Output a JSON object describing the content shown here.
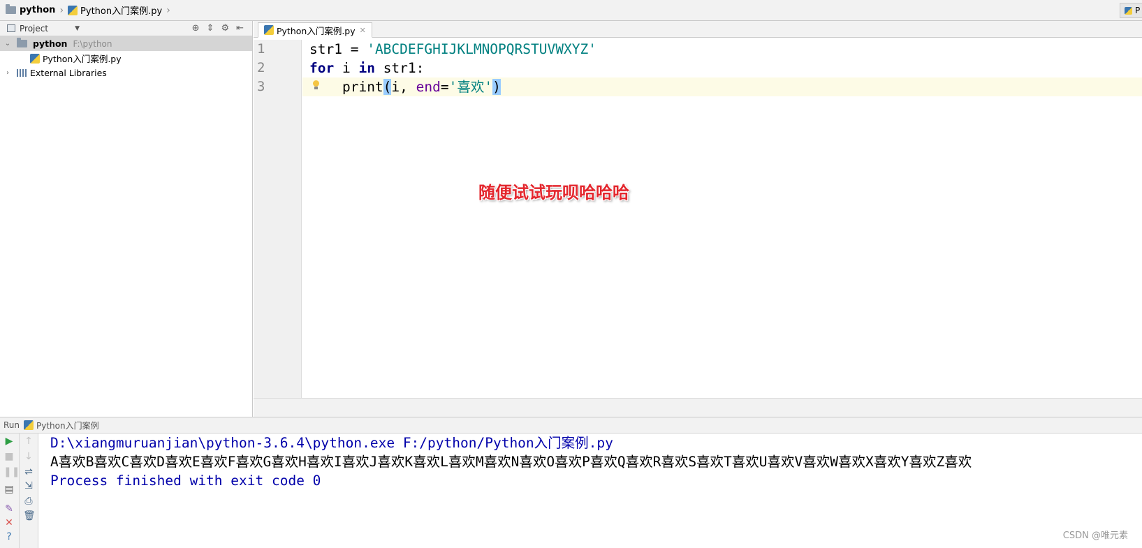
{
  "nav": {
    "project": "python",
    "file": "Python入门案例.py",
    "right_tab": "P"
  },
  "project_panel": {
    "title": "Project",
    "root": {
      "name": "python",
      "path": "F:\\python"
    },
    "file": "Python入门案例.py",
    "libraries": "External Libraries"
  },
  "editor": {
    "tab_label": "Python入门案例.py",
    "line_numbers": [
      "1",
      "2",
      "3"
    ],
    "line1": {
      "var": "str1",
      "eq": " = ",
      "str": "'ABCDEFGHIJKLMNOPQRSTUVWXYZ'"
    },
    "line2": {
      "for": "for",
      "i": " i ",
      "in": "in",
      "rest": " str1:"
    },
    "line3": {
      "indent": "    ",
      "fn": "print",
      "open": "(",
      "args": "i, ",
      "param": "end",
      "eq": "=",
      "str": "'喜欢'",
      "close": ")"
    }
  },
  "overlay_text": "随便试试玩呗哈哈哈",
  "run": {
    "label": "Run",
    "config": "Python入门案例",
    "output": [
      "D:\\xiangmuruanjian\\python-3.6.4\\python.exe F:/python/Python入门案例.py",
      "A喜欢B喜欢C喜欢D喜欢E喜欢F喜欢G喜欢H喜欢I喜欢J喜欢K喜欢L喜欢M喜欢N喜欢O喜欢P喜欢Q喜欢R喜欢S喜欢T喜欢U喜欢V喜欢W喜欢X喜欢Y喜欢Z喜欢",
      "Process finished with exit code 0"
    ]
  },
  "watermark": "CSDN @唯元素",
  "colors": {
    "keyword": "#000080",
    "string": "#008080",
    "param": "#660099",
    "overlay": "#e3262d",
    "console_blue": "#0000aa"
  }
}
